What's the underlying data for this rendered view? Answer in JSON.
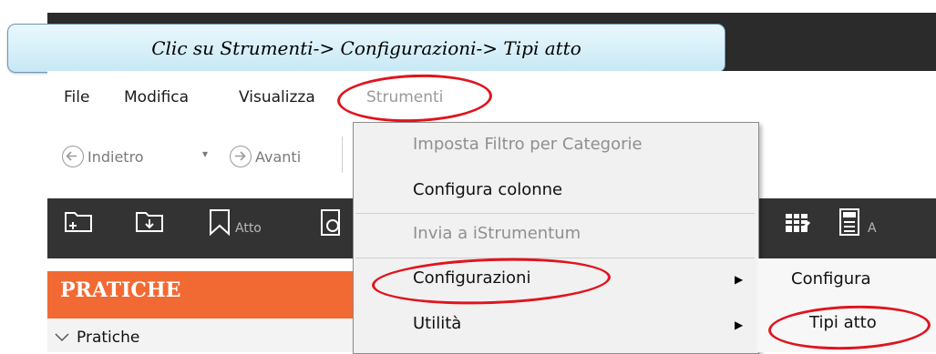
{
  "instruction": "Clic su Strumenti-> Configurazioni-> Tipi atto",
  "menubar": {
    "file": "File",
    "modifica": "Modifica",
    "visualizza": "Visualizza",
    "strumenti": "Strumenti"
  },
  "nav": {
    "back": "Indietro",
    "forward": "Avanti",
    "dropdown_glyph": "▾"
  },
  "toolbar": {
    "atto": "Atto",
    "a_partial": "A"
  },
  "dropdown": {
    "items": [
      {
        "label": "Imposta Filtro per Categorie",
        "enabled": false
      },
      {
        "label": "Configura colonne",
        "enabled": true
      },
      {
        "label": "Invia a iStrumentum",
        "enabled": false
      },
      {
        "label": "Configurazioni",
        "enabled": true,
        "has_submenu": true
      },
      {
        "label": "Utilità",
        "enabled": true,
        "has_submenu": true
      }
    ]
  },
  "submenu": {
    "items": [
      {
        "label": "Configura"
      },
      {
        "label": "Tipi atto"
      }
    ]
  },
  "left_panel": {
    "title": "PRATICHE",
    "tree_item": "Pratiche"
  },
  "colors": {
    "highlight_ring": "#e0141e",
    "pratiche_header": "#f26a33",
    "dark_toolbar": "#333333"
  }
}
